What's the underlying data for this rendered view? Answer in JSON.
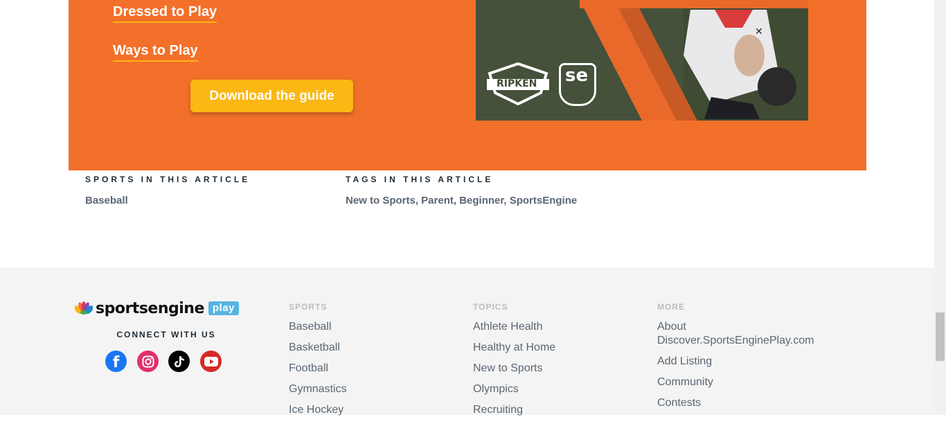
{
  "promo": {
    "links": [
      "Dressed to Play",
      "Ways to Play"
    ],
    "download_label": "Download the guide",
    "image_logos": [
      "RIPKEN",
      "se"
    ]
  },
  "article_meta": {
    "sports_heading": "SPORTS IN THIS ARTICLE",
    "sports_value": "Baseball",
    "tags_heading": "TAGS IN THIS ARTICLE",
    "tags_value": "New to Sports, Parent, Beginner, SportsEngine"
  },
  "footer": {
    "logo_word": "sportsengine",
    "logo_badge": "play",
    "connect_label": "CONNECT WITH US",
    "social": [
      {
        "icon": "facebook-icon",
        "color": "#1877f2"
      },
      {
        "icon": "instagram-icon",
        "color": "#e1306c"
      },
      {
        "icon": "tiktok-icon",
        "color": "#000000"
      },
      {
        "icon": "youtube-icon",
        "color": "#ff0000"
      }
    ],
    "columns": [
      {
        "heading": "SPORTS",
        "items": [
          "Baseball",
          "Basketball",
          "Football",
          "Gymnastics",
          "Ice Hockey"
        ]
      },
      {
        "heading": "TOPICS",
        "items": [
          "Athlete Health",
          "Healthy at Home",
          "New to Sports",
          "Olympics",
          "Recruiting"
        ]
      },
      {
        "heading": "MORE",
        "items": [
          "About Discover.SportsEnginePlay.com",
          "Add Listing",
          "Community",
          "Contests"
        ]
      }
    ]
  },
  "colors": {
    "brand_orange": "#f2702a",
    "button_yellow": "#fbb713",
    "footer_bg": "#f4f4f4"
  }
}
